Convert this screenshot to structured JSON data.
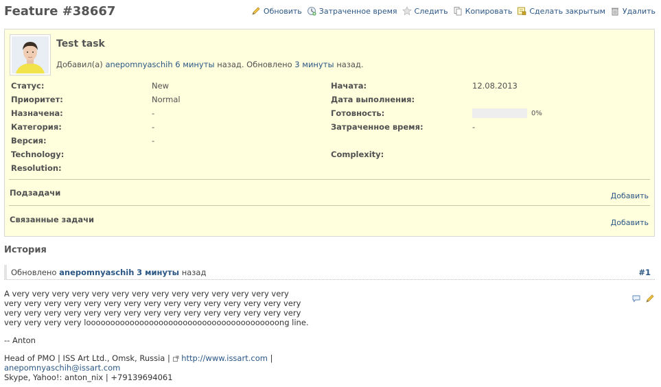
{
  "page": {
    "title": "Feature #38667"
  },
  "actions": [
    {
      "label": "Обновить",
      "icon": "edit-icon"
    },
    {
      "label": "Затраченное время",
      "icon": "time-add-icon"
    },
    {
      "label": "Следить",
      "icon": "star-icon"
    },
    {
      "label": "Копировать",
      "icon": "copy-icon"
    },
    {
      "label": "Сделать закрытым",
      "icon": "lock-icon"
    },
    {
      "label": "Удалить",
      "icon": "trash-icon"
    }
  ],
  "issue": {
    "subject": "Test task",
    "added_prefix": "Добавил(а)",
    "author": "anepomnyaschih",
    "added_ago": "6 минуты",
    "added_suffix": "назад. Обновлено",
    "updated_ago": "3 минуты",
    "updated_suffix": "назад.",
    "attributes": {
      "status_label": "Статус:",
      "status": "New",
      "start_label": "Начата:",
      "start": "12.08.2013",
      "priority_label": "Приоритет:",
      "priority": "Normal",
      "due_label": "Дата выполнения:",
      "due": "",
      "assigned_label": "Назначена:",
      "assigned": "-",
      "done_label": "Готовность:",
      "done_percent": 0,
      "done_text": "0%",
      "category_label": "Категория:",
      "category": "-",
      "spent_label": "Затраченное время:",
      "spent": "-",
      "version_label": "Версия:",
      "version": "-",
      "technology_label": "Technology:",
      "technology": "",
      "complexity_label": "Complexity:",
      "complexity": "",
      "resolution_label": "Resolution:",
      "resolution": ""
    },
    "subtasks": {
      "title": "Подзадачи",
      "add": "Добавить"
    },
    "relations": {
      "title": "Связанные задачи",
      "add": "Добавить"
    }
  },
  "history": {
    "title": "История",
    "journal": {
      "prefix": "Обновлено",
      "author": "anepomnyaschih",
      "ago": "3 минуты",
      "suffix": "назад",
      "number": "#1",
      "lines": [
        "A very very very very very very very very very very very very very very",
        "very very very very very very very very very very very very very very very",
        "very very very very very very very very very very very very very very very",
        "very very very very loooooooooooooooooooooooooooooooooooooooong line."
      ],
      "signoff": "-- Anton",
      "sig_prefix": "Head of PMO | ISS Art Ltd., Omsk, Russia |",
      "sig_site": "http://www.issart.com",
      "sig_sep": "|",
      "sig_email": "anepomnyaschih@issart.com",
      "sig_contacts": "Skype, Yahoo!: anton_nix | +79139694061"
    }
  },
  "colors": {
    "issue_bg": "#ffffdd",
    "link": "#2a5685"
  }
}
